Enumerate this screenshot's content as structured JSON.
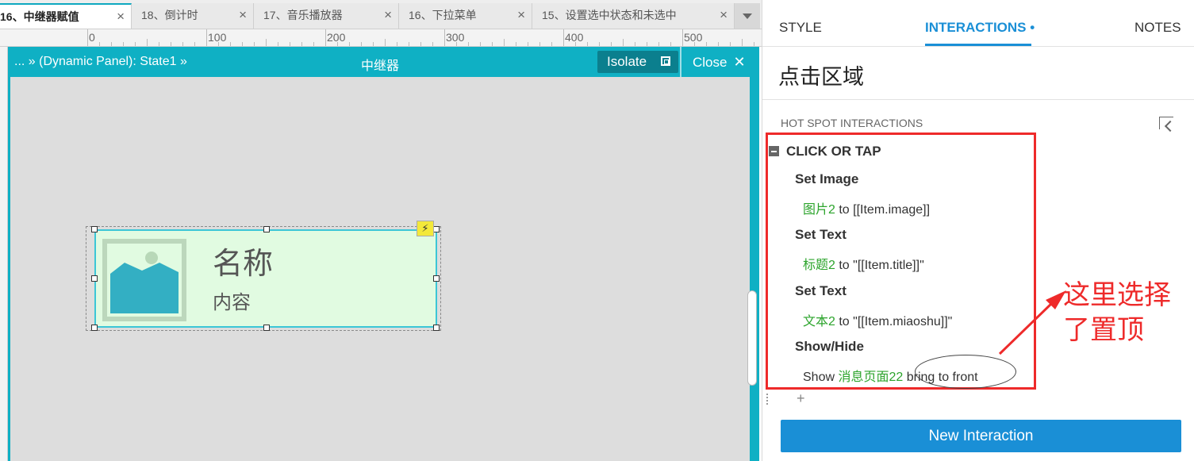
{
  "tabs": [
    {
      "label": "16、中继器赋值",
      "active": true
    },
    {
      "label": "18、倒计时",
      "active": false
    },
    {
      "label": "17、音乐播放器",
      "active": false
    },
    {
      "label": "16、下拉菜单",
      "active": false
    },
    {
      "label": "15、设置选中状态和未选中",
      "active": false
    }
  ],
  "tab_close_glyph": "×",
  "ruler": {
    "labels": [
      "0",
      "100",
      "200",
      "300",
      "400",
      "500"
    ]
  },
  "panel": {
    "breadcrumb": "... » (Dynamic Panel): State1 »",
    "title": "中继器",
    "isolate_label": "Isolate",
    "close_label": "Close",
    "close_glyph": "✕"
  },
  "widget": {
    "title": "名称",
    "description": "内容",
    "lightning_glyph": "⚡"
  },
  "inspector": {
    "tabs": {
      "style": "STYLE",
      "interactions": "INTERACTIONS",
      "interactions_dot": "•",
      "notes": "NOTES"
    },
    "widget_name": "点击区域",
    "section_title": "HOT SPOT INTERACTIONS",
    "event": "CLICK OR TAP",
    "actions": [
      {
        "title": "Set Image",
        "target": "图片2",
        "connector": " to ",
        "value": "[[Item.image]]"
      },
      {
        "title": "Set Text",
        "target": "标题2",
        "connector": " to ",
        "value": "\"[[Item.title]]\""
      },
      {
        "title": "Set Text",
        "target": "文本2",
        "connector": " to ",
        "value": "\"[[Item.miaoshu]]\""
      },
      {
        "title": "Show/Hide",
        "prefix": "Show ",
        "target": "消息页面22",
        "value": " bring to front"
      }
    ],
    "add_glyph": "+",
    "new_interaction_label": "New Interaction"
  },
  "annotation": {
    "line1": "这里选择",
    "line2": "了置顶"
  },
  "colors": {
    "accent": "#1a8fd6",
    "panel_teal": "#0fb0c4",
    "annotation_red": "#ee2a2a",
    "target_green": "#2ca42c",
    "widget_bg": "#e1fbe1"
  }
}
